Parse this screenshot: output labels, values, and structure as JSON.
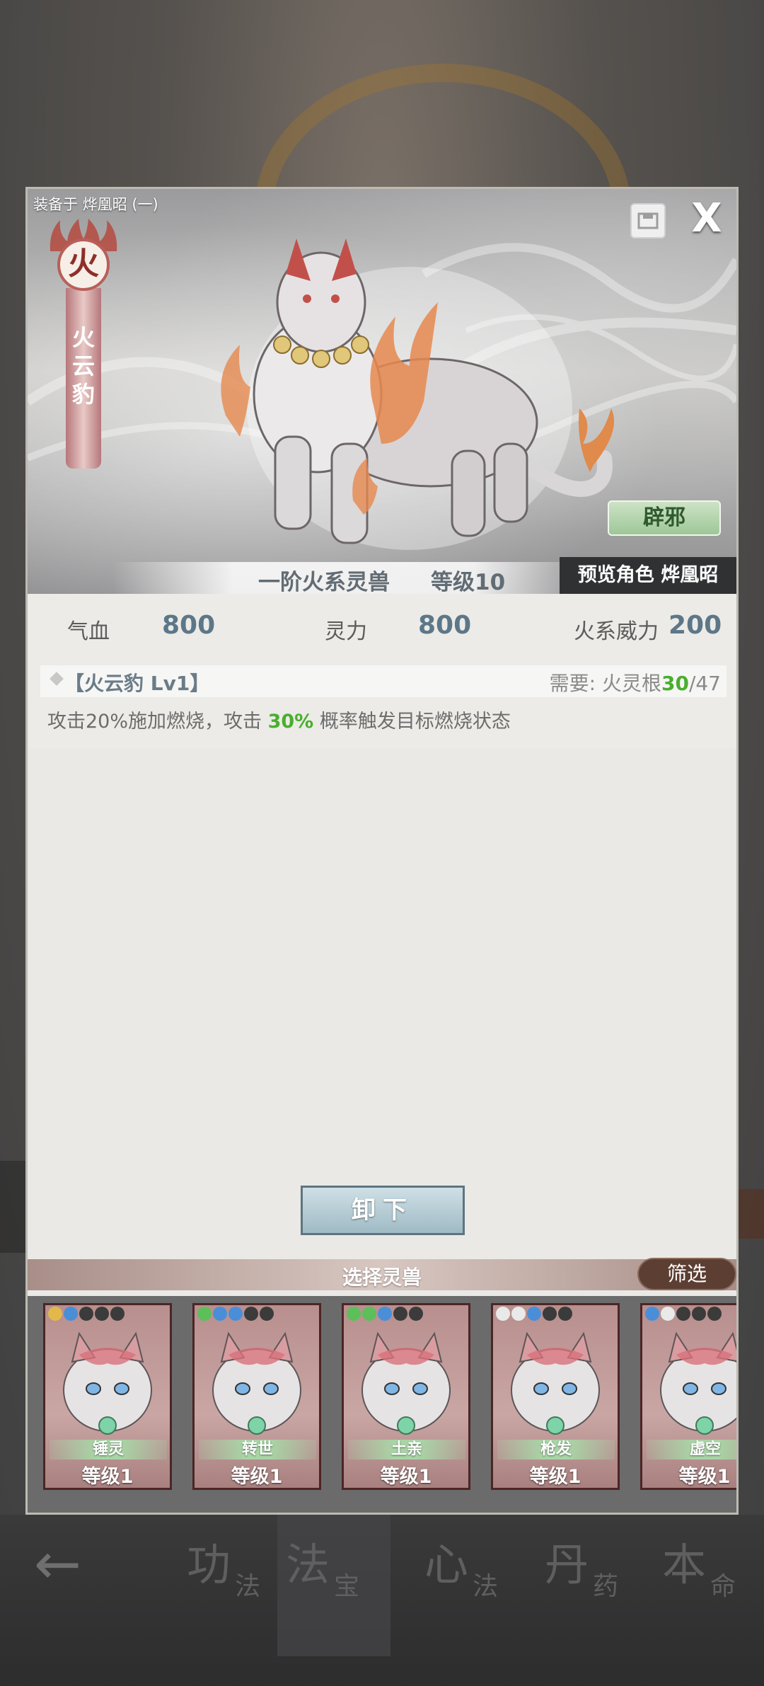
{
  "colors": {
    "accent_green": "#4bae2f",
    "value_blue": "#5d7788",
    "fire_red": "#b95f59",
    "filter_brown": "#5c3e33"
  },
  "dialog": {
    "equipped_label": "装备于 烨凰昭 (一)",
    "element_char": "火",
    "beast_name_vertical": "火云豹",
    "skill_tag": "辟邪",
    "rank_text": "一阶火系灵兽",
    "level_text": "等级10",
    "preview_text": "预览角色 烨凰昭",
    "close_glyph": "X",
    "icons": {
      "save": "save-icon",
      "close": "close-icon"
    }
  },
  "stats": {
    "hp_label": "气血",
    "hp_value": "800",
    "spirit_label": "灵力",
    "spirit_value": "800",
    "fire_power_label": "火系威力",
    "fire_power_value": "200"
  },
  "skill": {
    "name": "【火云豹 Lv1】",
    "req_prefix": "需要:  火灵根",
    "req_current": "30",
    "req_total": "/47",
    "desc_part1": "攻击20%施加燃烧，攻击 ",
    "desc_highlight": "30%",
    "desc_part2": " 概率触发目标燃烧状态"
  },
  "actions": {
    "unequip": "卸下",
    "select_title": "选择灵兽",
    "filter": "筛选"
  },
  "cards": [
    {
      "name": "锤灵",
      "level": "等级1",
      "paws": [
        "gold",
        "blue",
        "dark",
        "dark",
        "dark"
      ]
    },
    {
      "name": "转世",
      "level": "等级1",
      "paws": [
        "green",
        "blue",
        "blue",
        "dark",
        "dark"
      ]
    },
    {
      "name": "土亲",
      "level": "等级1",
      "paws": [
        "green",
        "green",
        "blue",
        "dark",
        "dark"
      ]
    },
    {
      "name": "枪发",
      "level": "等级1",
      "paws": [
        "white",
        "white",
        "blue",
        "dark",
        "dark"
      ]
    },
    {
      "name": "虚空",
      "level": "等级1",
      "paws": [
        "blue",
        "white",
        "dark",
        "dark",
        "dark"
      ]
    }
  ],
  "bottom_nav": {
    "back_glyph": "←",
    "items": [
      {
        "big": "功",
        "small": "法"
      },
      {
        "big": "法",
        "small": "宝"
      },
      {
        "big": "心",
        "small": "法"
      },
      {
        "big": "丹",
        "small": "药"
      },
      {
        "big": "本",
        "small": "命"
      }
    ]
  }
}
